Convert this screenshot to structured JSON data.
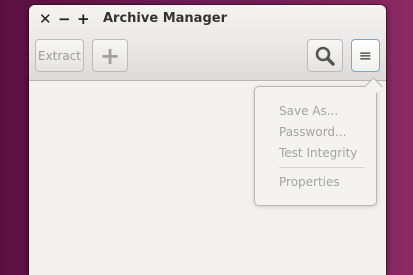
{
  "window": {
    "title": "Archive Manager"
  },
  "window_controls": {
    "close": "✕",
    "minimize": "−",
    "maximize": "+"
  },
  "toolbar": {
    "extract_label": "Extract",
    "add_icon": "plus-icon",
    "search_icon": "search-icon",
    "menu_icon": "hamburger-menu-icon"
  },
  "menu": {
    "items": [
      {
        "label": "Save As...",
        "enabled": false
      },
      {
        "label": "Password...",
        "enabled": false
      },
      {
        "label": "Test Integrity",
        "enabled": false
      },
      {
        "label": "Properties",
        "enabled": false
      }
    ]
  },
  "colors": {
    "desktop_background": "#6e1a52",
    "window_background": "#f2f1f0",
    "menu_button_focus_border": "#7aa6d3",
    "disabled_text": "#a4a3a1"
  }
}
